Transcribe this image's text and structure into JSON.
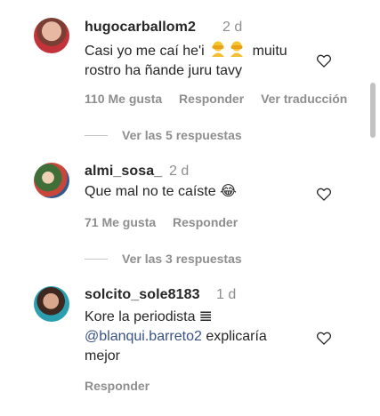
{
  "comments": [
    {
      "username": "hugocarballom2",
      "time": "2 d",
      "text_line1": "Casi yo me caí he'i",
      "text_line1_end": "muitu",
      "text_line2": "rostro ha ñande juru tavy",
      "likes": "110 Me gusta",
      "reply": "Responder",
      "translate": "Ver traducción",
      "replies_label": "Ver las 5 respuestas"
    },
    {
      "username": "almi_sosa_",
      "time": "2 d",
      "text": "Que mal no te caíste 😂",
      "likes": "71 Me gusta",
      "reply": "Responder",
      "replies_label": "Ver las 3 respuestas"
    },
    {
      "username": "solcito_sole8183",
      "time": "1 d",
      "text_line1": "Kore la periodista 𝌆",
      "mention": "@blanqui.barreto2",
      "text_line2_end": "explicaría",
      "text_line3": "mejor",
      "reply": "Responder"
    }
  ],
  "colors": {
    "text": "#262626",
    "secondary": "#8e8e8e",
    "mention": "#385185",
    "divider": "#c7c7c7"
  },
  "icons": [
    "heart-icon",
    "facepalm-emoji-icon",
    "laughing-emoji-icon"
  ]
}
